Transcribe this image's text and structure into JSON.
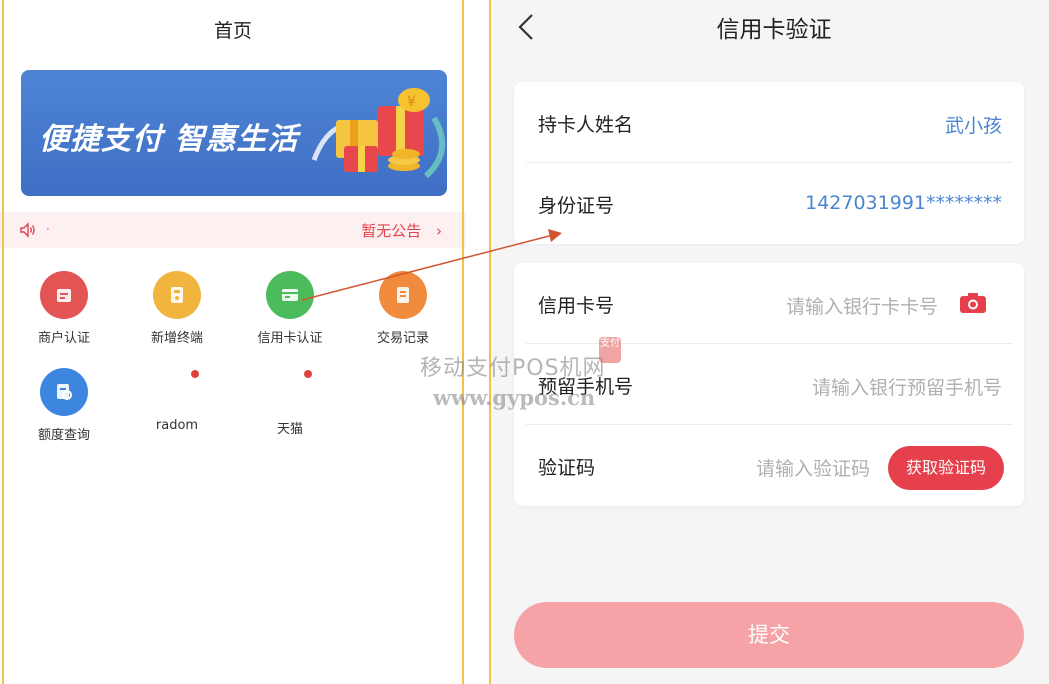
{
  "left": {
    "title": "首页",
    "banner_text": "便捷支付 智惠生活",
    "notice": {
      "dot": "·",
      "text": "暂无公告",
      "chevron": "›"
    },
    "grid": [
      {
        "label": "商户认证",
        "color": "#e35454",
        "icon": "store-icon"
      },
      {
        "label": "新增终端",
        "color": "#f1b43f",
        "icon": "terminal-icon"
      },
      {
        "label": "信用卡认证",
        "color": "#4cbb5c",
        "icon": "credit-card-icon"
      },
      {
        "label": "交易记录",
        "color": "#f08a3d",
        "icon": "records-icon"
      },
      {
        "label": "额度查询",
        "color": "#3d86e0",
        "icon": "limit-query-icon"
      },
      {
        "label": "radom",
        "color": "#e0413f",
        "icon": "dot"
      },
      {
        "label": "天猫",
        "color": "#e0413f",
        "icon": "dot"
      }
    ]
  },
  "right": {
    "title": "信用卡验证",
    "card1": {
      "name_label": "持卡人姓名",
      "name_value": "武小孩",
      "id_label": "身份证号",
      "id_value": "1427031991********"
    },
    "card2": {
      "card_label": "信用卡号",
      "card_placeholder": "请输入银行卡卡号",
      "phone_label": "预留手机号",
      "phone_placeholder": "请输入银行预留手机号",
      "code_label": "验证码",
      "code_placeholder": "请输入验证码",
      "code_button": "获取验证码"
    },
    "submit": "提交"
  },
  "watermark": {
    "line1": "移动支付POS机网",
    "line2": "www.gypos.cn",
    "seal": "支付"
  },
  "colors": {
    "accent_red": "#e5404b",
    "link_blue": "#4a86d0",
    "border_yellow": "#f5c04a",
    "annotation_arrow": "#d2552f"
  }
}
